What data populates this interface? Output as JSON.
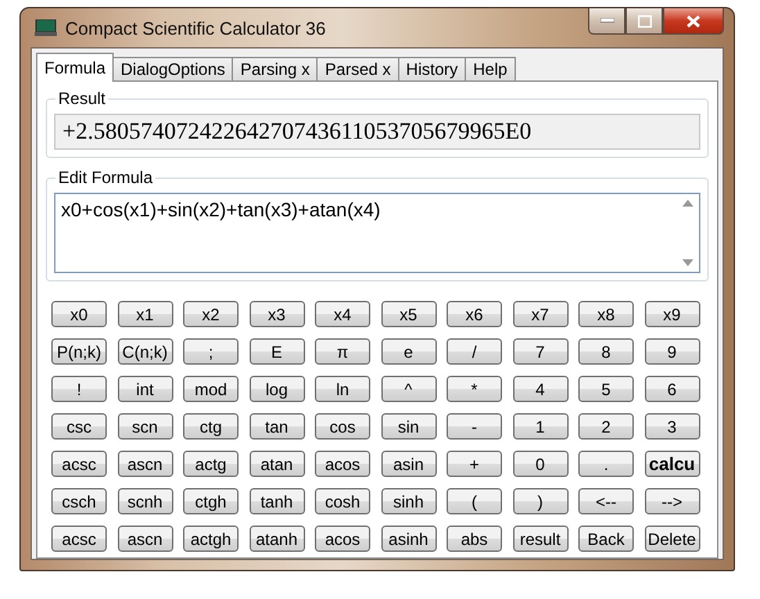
{
  "window": {
    "title": "Compact Scientific Calculator 36"
  },
  "tabs": [
    {
      "label": "Formula",
      "selected": true
    },
    {
      "label": "DialogOptions",
      "selected": false
    },
    {
      "label": "Parsing x",
      "selected": false
    },
    {
      "label": "Parsed x",
      "selected": false
    },
    {
      "label": "History",
      "selected": false
    },
    {
      "label": "Help",
      "selected": false
    }
  ],
  "result": {
    "label": "Result",
    "value": "+2.58057407242264270743611053705679965E0"
  },
  "formula": {
    "label": "Edit Formula",
    "value": "x0+cos(x1)+sin(x2)+tan(x3)+atan(x4)"
  },
  "keypad": [
    [
      {
        "label": "x0",
        "bold": false
      },
      {
        "label": "x1",
        "bold": false
      },
      {
        "label": "x2",
        "bold": false
      },
      {
        "label": "x3",
        "bold": false
      },
      {
        "label": "x4",
        "bold": false
      },
      {
        "label": "x5",
        "bold": false
      },
      {
        "label": "x6",
        "bold": false
      },
      {
        "label": "x7",
        "bold": false
      },
      {
        "label": "x8",
        "bold": false
      },
      {
        "label": "x9",
        "bold": false
      }
    ],
    [
      {
        "label": "P(n;k)",
        "bold": false
      },
      {
        "label": "C(n;k)",
        "bold": false
      },
      {
        "label": ";",
        "bold": false
      },
      {
        "label": "E",
        "bold": false
      },
      {
        "label": "π",
        "bold": false
      },
      {
        "label": "e",
        "bold": false
      },
      {
        "label": "/",
        "bold": false
      },
      {
        "label": "7",
        "bold": false
      },
      {
        "label": "8",
        "bold": false
      },
      {
        "label": "9",
        "bold": false
      }
    ],
    [
      {
        "label": "!",
        "bold": false
      },
      {
        "label": "int",
        "bold": false
      },
      {
        "label": "mod",
        "bold": false
      },
      {
        "label": "log",
        "bold": false
      },
      {
        "label": "ln",
        "bold": false
      },
      {
        "label": "^",
        "bold": false
      },
      {
        "label": "*",
        "bold": false
      },
      {
        "label": "4",
        "bold": false
      },
      {
        "label": "5",
        "bold": false
      },
      {
        "label": "6",
        "bold": false
      }
    ],
    [
      {
        "label": "csc",
        "bold": false
      },
      {
        "label": "scn",
        "bold": false
      },
      {
        "label": "ctg",
        "bold": false
      },
      {
        "label": "tan",
        "bold": false
      },
      {
        "label": "cos",
        "bold": false
      },
      {
        "label": "sin",
        "bold": false
      },
      {
        "label": "-",
        "bold": false
      },
      {
        "label": "1",
        "bold": false
      },
      {
        "label": "2",
        "bold": false
      },
      {
        "label": "3",
        "bold": false
      }
    ],
    [
      {
        "label": "acsc",
        "bold": false
      },
      {
        "label": "ascn",
        "bold": false
      },
      {
        "label": "actg",
        "bold": false
      },
      {
        "label": "atan",
        "bold": false
      },
      {
        "label": "acos",
        "bold": false
      },
      {
        "label": "asin",
        "bold": false
      },
      {
        "label": "+",
        "bold": false
      },
      {
        "label": "0",
        "bold": false
      },
      {
        "label": ".",
        "bold": false
      },
      {
        "label": "calcu",
        "bold": true
      }
    ],
    [
      {
        "label": "csch",
        "bold": false
      },
      {
        "label": "scnh",
        "bold": false
      },
      {
        "label": "ctgh",
        "bold": false
      },
      {
        "label": "tanh",
        "bold": false
      },
      {
        "label": "cosh",
        "bold": false
      },
      {
        "label": "sinh",
        "bold": false
      },
      {
        "label": "(",
        "bold": false
      },
      {
        "label": ")",
        "bold": false
      },
      {
        "label": "<--",
        "bold": false
      },
      {
        "label": "-->",
        "bold": false
      }
    ],
    [
      {
        "label": "acsc",
        "bold": false
      },
      {
        "label": "ascn",
        "bold": false
      },
      {
        "label": "actgh",
        "bold": false
      },
      {
        "label": "atanh",
        "bold": false
      },
      {
        "label": "acos",
        "bold": false
      },
      {
        "label": "asinh",
        "bold": false
      },
      {
        "label": "abs",
        "bold": false
      },
      {
        "label": "result",
        "bold": false
      },
      {
        "label": "Back",
        "bold": false
      },
      {
        "label": "Delete",
        "bold": false
      }
    ]
  ]
}
